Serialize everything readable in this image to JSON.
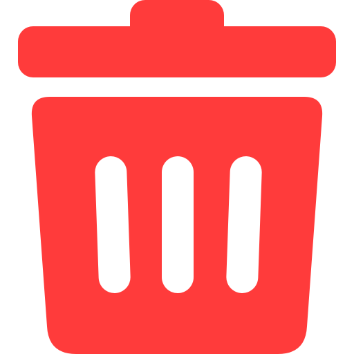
{
  "icon": {
    "name": "trash-icon",
    "color": "#FF3B3B",
    "slot_color": "#FFFFFF"
  }
}
